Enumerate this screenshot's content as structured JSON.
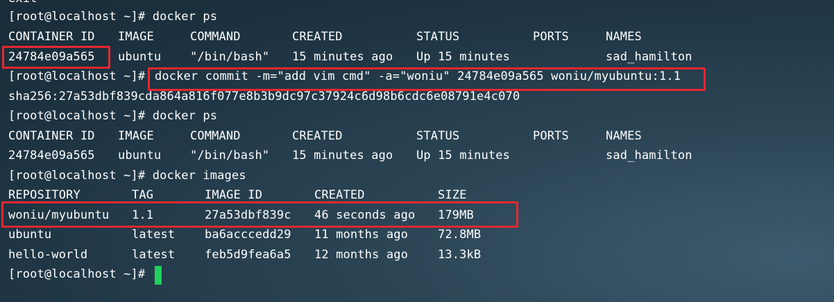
{
  "terminal": {
    "cut_top_text": "exit",
    "lines": {
      "l1": "[root@localhost ~]# docker ps",
      "l4": "[root@localhost ~]# ",
      "l4_cmd": "docker commit -m=\"add vim cmd\" -a=\"woniu\" 24784e09a565 woniu/myubuntu:1.1",
      "l5": "sha256:27a53dbf839cda864a816f077e8b3b9dc97c37924c6d98b6cdc6e08791e4c070",
      "l6": "[root@localhost ~]# docker ps",
      "l9": "[root@localhost ~]# docker images",
      "l14": "[root@localhost ~]# "
    },
    "ps_headers": [
      "CONTAINER ID",
      "IMAGE",
      "COMMAND",
      "CREATED",
      "STATUS",
      "PORTS",
      "NAMES"
    ],
    "ps_row": [
      "24784e09a565",
      "ubuntu",
      "\"/bin/bash\"",
      "15 minutes ago",
      "Up 15 minutes",
      "",
      "sad_hamilton"
    ],
    "images_headers": [
      "REPOSITORY",
      "TAG",
      "IMAGE ID",
      "CREATED",
      "SIZE"
    ],
    "images_rows": [
      [
        "woniu/myubuntu",
        "1.1",
        "27a53dbf839c",
        "46 seconds ago",
        "179MB"
      ],
      [
        "ubuntu",
        "latest",
        "ba6acccedd29",
        "11 months ago",
        "72.8MB"
      ],
      [
        "hello-world",
        "latest",
        "feb5d9fea6a5",
        "12 months ago",
        "13.3kB"
      ]
    ],
    "colors": {
      "background": "#1f3544",
      "text": "#ffffff",
      "highlight": "#e8282f",
      "cursor": "#1ed15c"
    }
  }
}
